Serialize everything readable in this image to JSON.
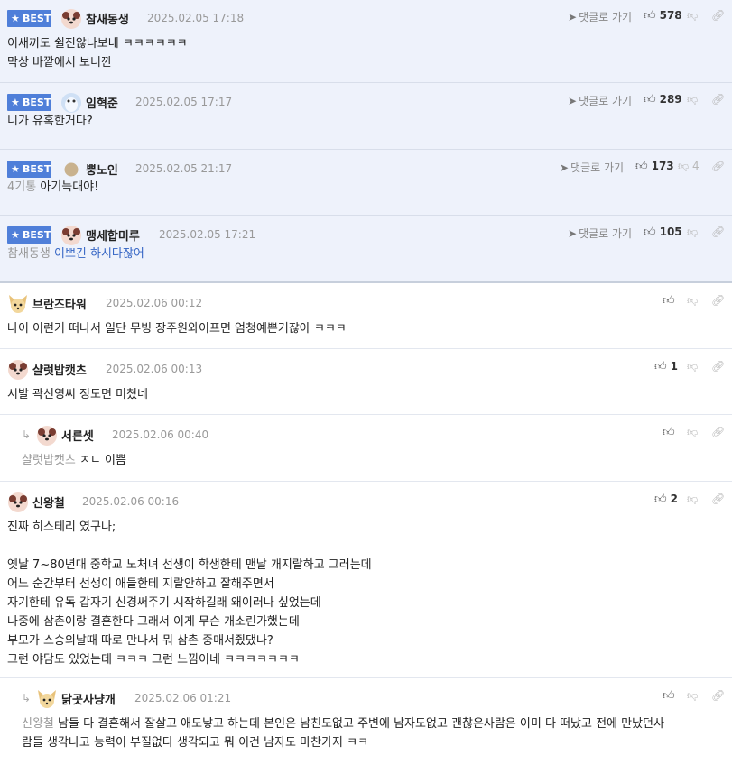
{
  "best_label": "BEST",
  "reply_link_label": "댓글로 가기",
  "comments": [
    {
      "nick": "참새동생",
      "date": "2025.02.05 17:18",
      "likes": "578",
      "dislikes": "",
      "body": "이새끼도 쉴진않나보네 ㅋㅋㅋㅋㅋㅋ\n막상 바깥에서 보니깐",
      "mention": ""
    },
    {
      "nick": "임혁준",
      "date": "2025.02.05 17:17",
      "likes": "289",
      "dislikes": "",
      "body": "니가 유혹한거다?",
      "mention": ""
    },
    {
      "nick": "뿡노인",
      "date": "2025.02.05 21:17",
      "likes": "173",
      "dislikes": "4",
      "body": "아기늑대야!",
      "mention": "4기통"
    },
    {
      "nick": "맹세합미루",
      "date": "2025.02.05 17:21",
      "likes": "105",
      "dislikes": "",
      "body": "이쁘긴 하시다잖어",
      "mention": "참새동생"
    },
    {
      "nick": "브란즈타워",
      "date": "2025.02.06 00:12",
      "likes": "",
      "dislikes": "",
      "body": "나이 이런거 떠나서 일단 무빙 장주원와이프면 엄청예쁜거잖아 ㅋㅋㅋ",
      "mention": ""
    },
    {
      "nick": "샬럿밥캣츠",
      "date": "2025.02.06 00:13",
      "likes": "1",
      "dislikes": "",
      "body": "시발 곽선영씨 정도면 미쳤네",
      "mention": ""
    },
    {
      "nick": "서른셋",
      "date": "2025.02.06 00:40",
      "likes": "",
      "dislikes": "",
      "body": "ㅈㄴ 이쁨",
      "mention": "샬럿밥캣츠"
    },
    {
      "nick": "신왕철",
      "date": "2025.02.06 00:16",
      "likes": "2",
      "dislikes": "",
      "body": "진짜 히스테리 였구나;\n\n옛날 7~80년대 중학교 노처녀 선생이 학생한테 맨날 개지랄하고 그러는데\n어느 순간부터 선생이 애들한테 지랄안하고 잘해주면서\n자기한테 유독 갑자기 신경써주기 시작하길래 왜이러나 싶었는데\n나중에 삼촌이랑 결혼한다 그래서 이게 무슨 개소린가했는데\n부모가 스승의날때 따로 만나서 뭐 삼촌 중매서줬댔나?\n그런 야담도 있었는데 ㅋㅋㅋ 그런 느낌이네 ㅋㅋㅋㅋㅋㅋㅋ",
      "mention": ""
    },
    {
      "nick": "닭곳사냥개",
      "date": "2025.02.06 01:21",
      "likes": "",
      "dislikes": "",
      "body": "남들 다 결혼해서 잘살고 애도낳고 하는데 본인은 남친도없고 주변에 남자도없고 괜찮은사람은 이미 다 떠났고 전에 만났던사\n람들 생각나고 능력이 부질없다 생각되고 뭐 이건 남자도 마찬가지 ㅋㅋ",
      "mention": "신왕철"
    }
  ],
  "colors": {
    "best_bg": "#eef2fb",
    "badge": "#4f7fd9",
    "text": "#222222",
    "muted": "#999999"
  }
}
